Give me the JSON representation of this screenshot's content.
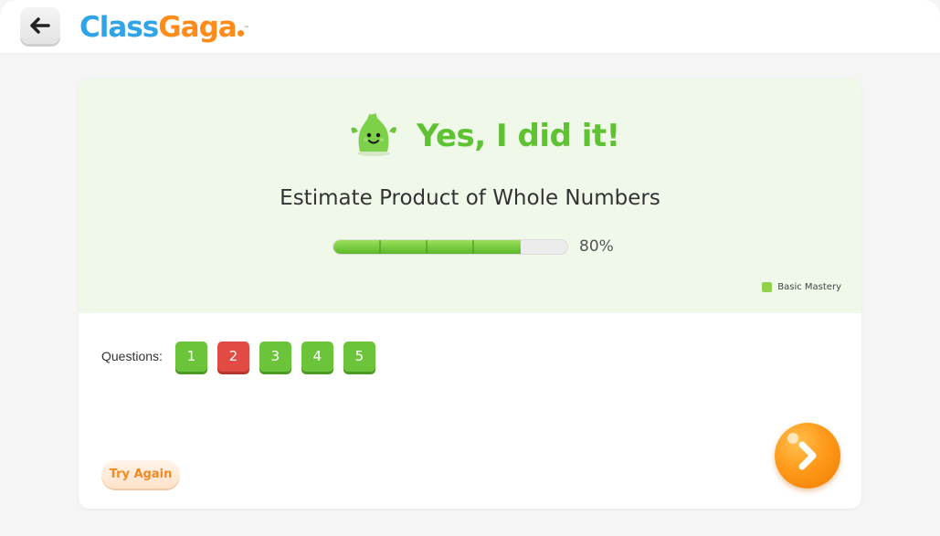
{
  "header": {
    "logo_part1": "Class",
    "logo_part2": "Gaga",
    "logo_tm": "™",
    "back_icon": "arrow-left-icon"
  },
  "result": {
    "headline": "Yes, I did it!",
    "skill_title": "Estimate Product of Whole Numbers",
    "progress_percent": 80,
    "progress_label": "80%",
    "legend_label": "Basic Mastery",
    "mascot_icon": "green-monster-mascot-icon"
  },
  "questions": {
    "label": "Questions:",
    "items": [
      {
        "number": "1",
        "status": "correct"
      },
      {
        "number": "2",
        "status": "wrong"
      },
      {
        "number": "3",
        "status": "correct"
      },
      {
        "number": "4",
        "status": "correct"
      },
      {
        "number": "5",
        "status": "correct"
      }
    ]
  },
  "actions": {
    "try_again_label": "Try Again",
    "next_icon": "chevron-right-icon"
  },
  "colors": {
    "brand_blue": "#2fa4e6",
    "brand_orange": "#ff8c1a",
    "success_green": "#5fc233",
    "error_red": "#e24a44"
  }
}
